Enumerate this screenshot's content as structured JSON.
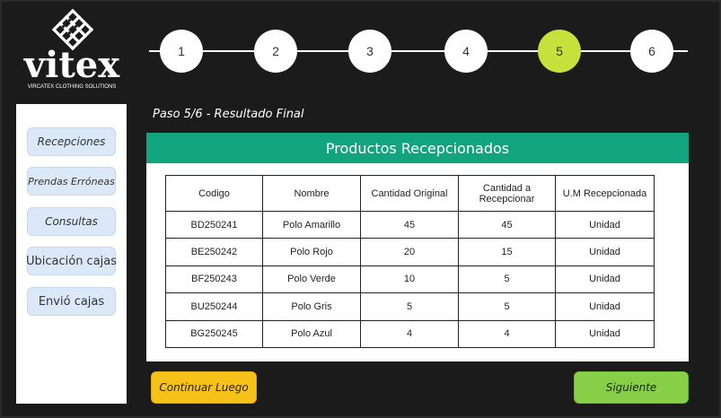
{
  "brand": {
    "name": "vitex",
    "tagline": "VIRCATEX CLOTHING SOLUTIONS",
    "icon": "woven-diamond-logo"
  },
  "stepper": {
    "steps": [
      "1",
      "2",
      "3",
      "4",
      "5",
      "6"
    ],
    "active_step": "5",
    "active_color": "#c6e03c"
  },
  "sidebar": {
    "items": [
      {
        "label": "Recepciones"
      },
      {
        "label": "Prendas Erróneas"
      },
      {
        "label": "Consultas"
      },
      {
        "label": "Ubicación cajas"
      },
      {
        "label": "Envió cajas"
      }
    ]
  },
  "page": {
    "title": "Paso 5/6 - Resultado Final"
  },
  "panel": {
    "title": "Productos Recepcionados",
    "header_color": "#12a37f",
    "columns": [
      "Codigo",
      "Nombre",
      "Cantidad Original",
      "Cantidad a Recepcionar",
      "U.M Recepcionada"
    ],
    "rows": [
      [
        "BD250241",
        "Polo Amarillo",
        "45",
        "45",
        "Unidad"
      ],
      [
        "BE250242",
        "Polo Rojo",
        "20",
        "15",
        "Unidad"
      ],
      [
        "BF250243",
        "Polo Verde",
        "10",
        "5",
        "Unidad"
      ],
      [
        "BU250244",
        "Polo Gris",
        "5",
        "5",
        "Unidad"
      ],
      [
        "BG250245",
        "Polo Azul",
        "4",
        "4",
        "Unidad"
      ]
    ]
  },
  "actions": {
    "later_label": "Continuar Luego",
    "later_color": "#f6c21a",
    "next_label": "Siguiente",
    "next_color": "#86cf47"
  }
}
